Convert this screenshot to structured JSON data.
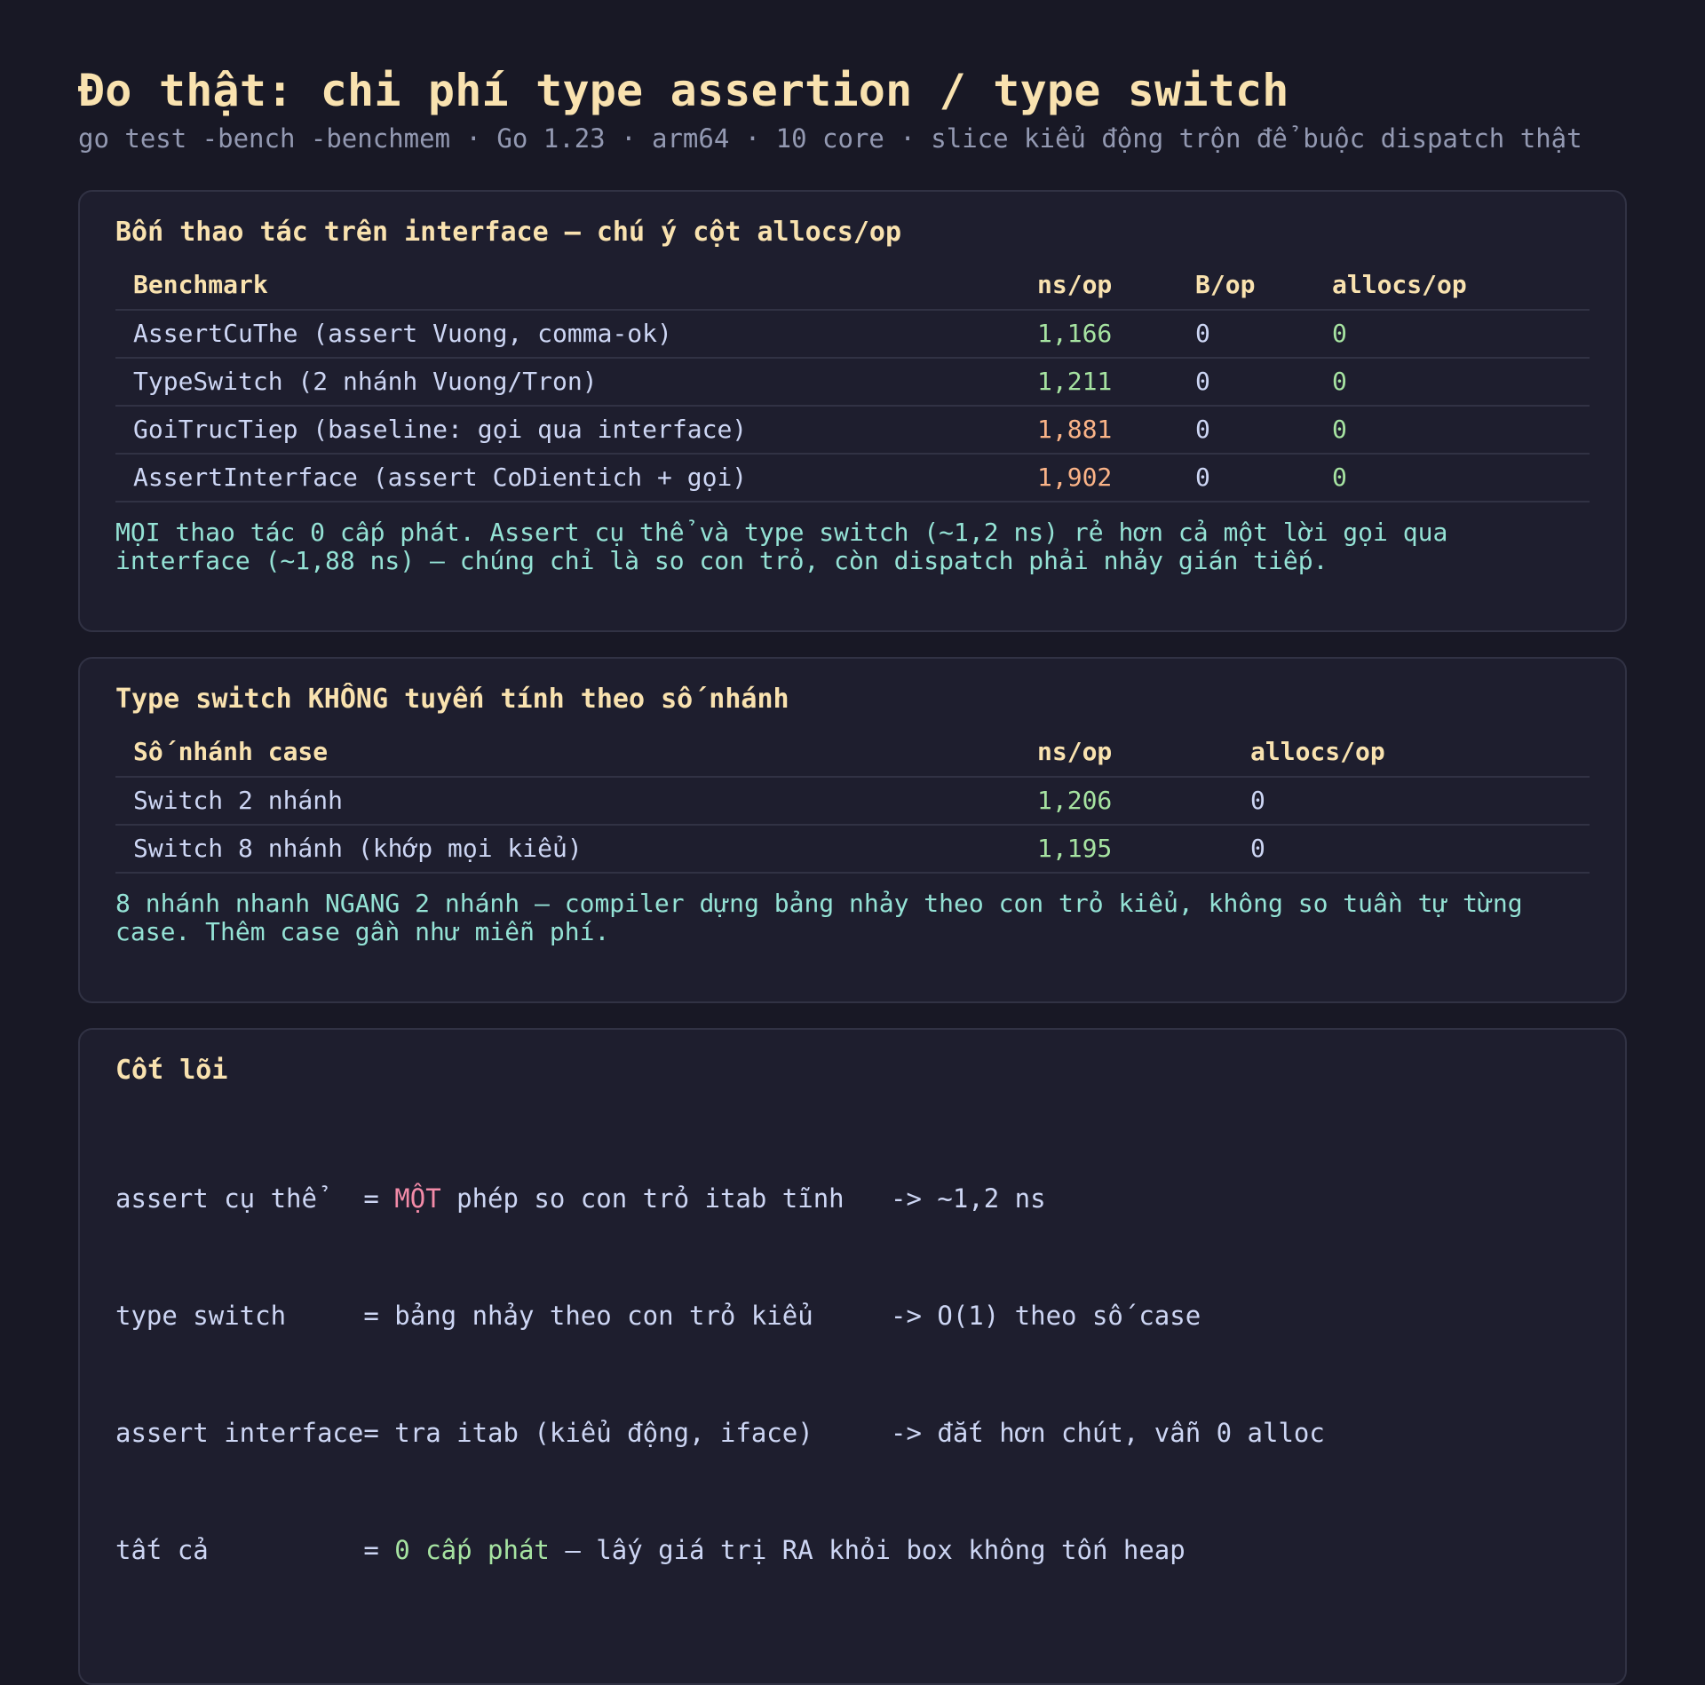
{
  "header": {
    "title": "Đo thật: chi phí type assertion / type switch",
    "subtitle": "go test -bench -benchmem · Go 1.23 · arm64 · 10 core · slice kiểu động trộn để buộc dispatch thật"
  },
  "card1": {
    "title": "Bốn thao tác trên interface — chú ý cột allocs/op",
    "columns": [
      "Benchmark",
      "ns/op",
      "B/op",
      "allocs/op"
    ],
    "rows": [
      {
        "name": "AssertCuThe (assert Vuong, comma-ok)",
        "ns": "1,166",
        "bop": "0",
        "allocs": "0"
      },
      {
        "name": "TypeSwitch (2 nhánh Vuong/Tron)",
        "ns": "1,211",
        "bop": "0",
        "allocs": "0"
      },
      {
        "name": "GoiTrucTiep (baseline: gọi qua interface)",
        "ns": "1,881",
        "bop": "0",
        "allocs": "0"
      },
      {
        "name": "AssertInterface (assert CoDientich + gọi)",
        "ns": "1,902",
        "bop": "0",
        "allocs": "0"
      }
    ],
    "note": "MỌI thao tác 0 cấp phát. Assert cụ thể và type switch (~1,2 ns) rẻ hơn cả một lời gọi qua interface (~1,88 ns) — chúng chỉ là so con trỏ, còn dispatch phải nhảy gián tiếp."
  },
  "card2": {
    "title": "Type switch KHÔNG tuyến tính theo số nhánh",
    "columns": [
      "Số nhánh case",
      "ns/op",
      "allocs/op"
    ],
    "rows": [
      {
        "name": "Switch 2 nhánh",
        "ns": "1,206",
        "allocs": "0"
      },
      {
        "name": "Switch 8 nhánh (khớp mọi kiểu)",
        "ns": "1,195",
        "allocs": "0"
      }
    ],
    "note": "8 nhánh nhanh NGANG 2 nhánh — compiler dựng bảng nhảy theo con trỏ kiểu, không so tuần tự từng case. Thêm case gần như miễn phí."
  },
  "card3": {
    "title": "Cốt lõi",
    "lines": [
      {
        "label": "assert cụ thể   ",
        "eq": "= ",
        "hl": "MỘT",
        "rest": " phép so con trỏ itab tĩnh   ",
        "result": "-> ~1,2 ns"
      },
      {
        "label": "type switch     ",
        "eq": "= ",
        "hl": "",
        "rest": "bảng nhảy theo con trỏ kiểu     ",
        "result": "-> O(1) theo số case"
      },
      {
        "label": "assert interface",
        "eq": "= ",
        "hl": "",
        "rest": "tra itab (kiểu động, iface)     ",
        "result": "-> đắt hơn chút, vẫn 0 alloc"
      },
      {
        "label": "tất cả          ",
        "eq": "= ",
        "hl": "0 cấp phát",
        "rest": " — lấy giá trị RA khỏi box không tốn heap",
        "result": ""
      }
    ]
  },
  "colors": {
    "background": "#181825",
    "card": "#1e1e2e",
    "accent_yellow": "#f9e2af",
    "fast_green": "#a6e3a1",
    "slow_orange": "#fab387",
    "note_teal": "#94e2d5",
    "highlight_pink": "#f38ba8"
  }
}
